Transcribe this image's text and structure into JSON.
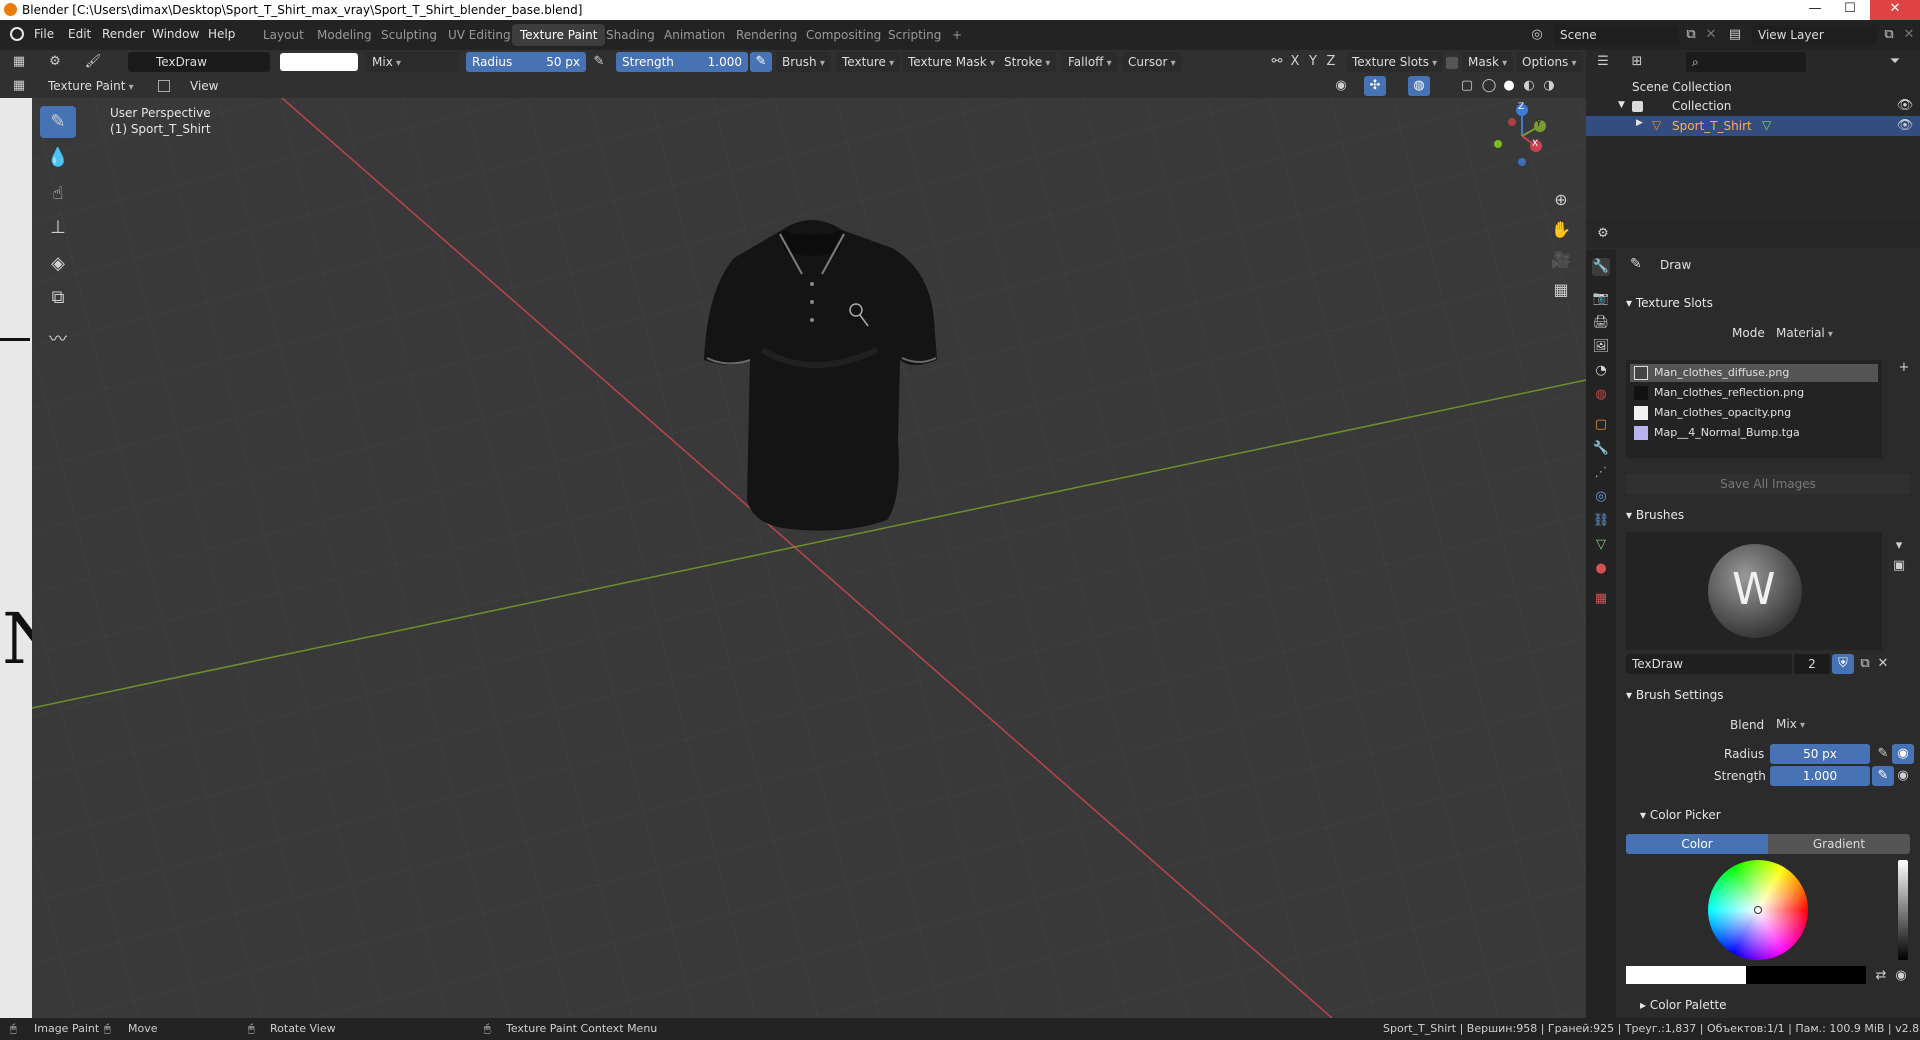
{
  "window": {
    "title": "Blender [C:\\Users\\dimax\\Desktop\\Sport_T_Shirt_max_vray\\Sport_T_Shirt_blender_base.blend]",
    "min": "—",
    "max": "☐",
    "close": "✕"
  },
  "menu": [
    "File",
    "Edit",
    "Render",
    "Window",
    "Help"
  ],
  "workspaces": [
    "Layout",
    "Modeling",
    "Sculpting",
    "UV Editing",
    "Texture Paint",
    "Shading",
    "Animation",
    "Rendering",
    "Compositing",
    "Scripting",
    "+"
  ],
  "active_workspace": "Texture Paint",
  "scene": {
    "name": "Scene",
    "view_layer": "View Layer"
  },
  "tool_header": {
    "brush_name": "TexDraw",
    "blend": "Mix",
    "radius_label": "Radius",
    "radius_value": "50 px",
    "strength_label": "Strength",
    "strength_value": "1.000",
    "menus": [
      "Brush",
      "Texture",
      "Texture Mask",
      "Stroke",
      "Falloff",
      "Cursor"
    ],
    "axes": [
      "X",
      "Y",
      "Z"
    ],
    "texture_slots": "Texture Slots",
    "mask": "Mask",
    "options": "Options"
  },
  "viewport_header": {
    "mode": "Texture Paint",
    "view": "View"
  },
  "viewport": {
    "perspective": "User Perspective",
    "object": "(1) Sport_T_Shirt",
    "gizmo": {
      "x": "X",
      "y": "Y",
      "z": "Z"
    }
  },
  "outliner": {
    "root": "Scene Collection",
    "collection": "Collection",
    "object": "Sport_T_Shirt"
  },
  "properties": {
    "tool": "Draw",
    "texture_slots_title": "Texture Slots",
    "mode_label": "Mode",
    "mode_value": "Material",
    "slots": [
      "Man_clothes_diffuse.png",
      "Man_clothes_reflection.png",
      "Man_clothes_opacity.png",
      "Map__4_Normal_Bump.tga"
    ],
    "save_all": "Save All Images",
    "brushes_title": "Brushes",
    "brush_name": "TexDraw",
    "brush_users": "2",
    "brush_settings_title": "Brush Settings",
    "blend_label": "Blend",
    "blend_value": "Mix",
    "radius_label": "Radius",
    "radius_value": "50 px",
    "strength_label": "Strength",
    "strength_value": "1.000",
    "color_picker_title": "Color Picker",
    "color_tab": "Color",
    "gradient_tab": "Gradient",
    "color_palette_title": "Color Palette"
  },
  "status": {
    "image_paint": "Image Paint",
    "move": "Move",
    "rotate": "Rotate View",
    "context": "Texture Paint Context Menu",
    "stats": "Sport_T_Shirt | Вершин:958 | Граней:925 | Треуг.:1,837 | Объектов:1/1 | Пам.: 100.9 MiB | v2.82.7"
  },
  "colors": {
    "accent": "#4772b3",
    "x_axis": "#c9434e",
    "y_axis": "#7a9b32",
    "z_axis": "#3f7bd5"
  }
}
